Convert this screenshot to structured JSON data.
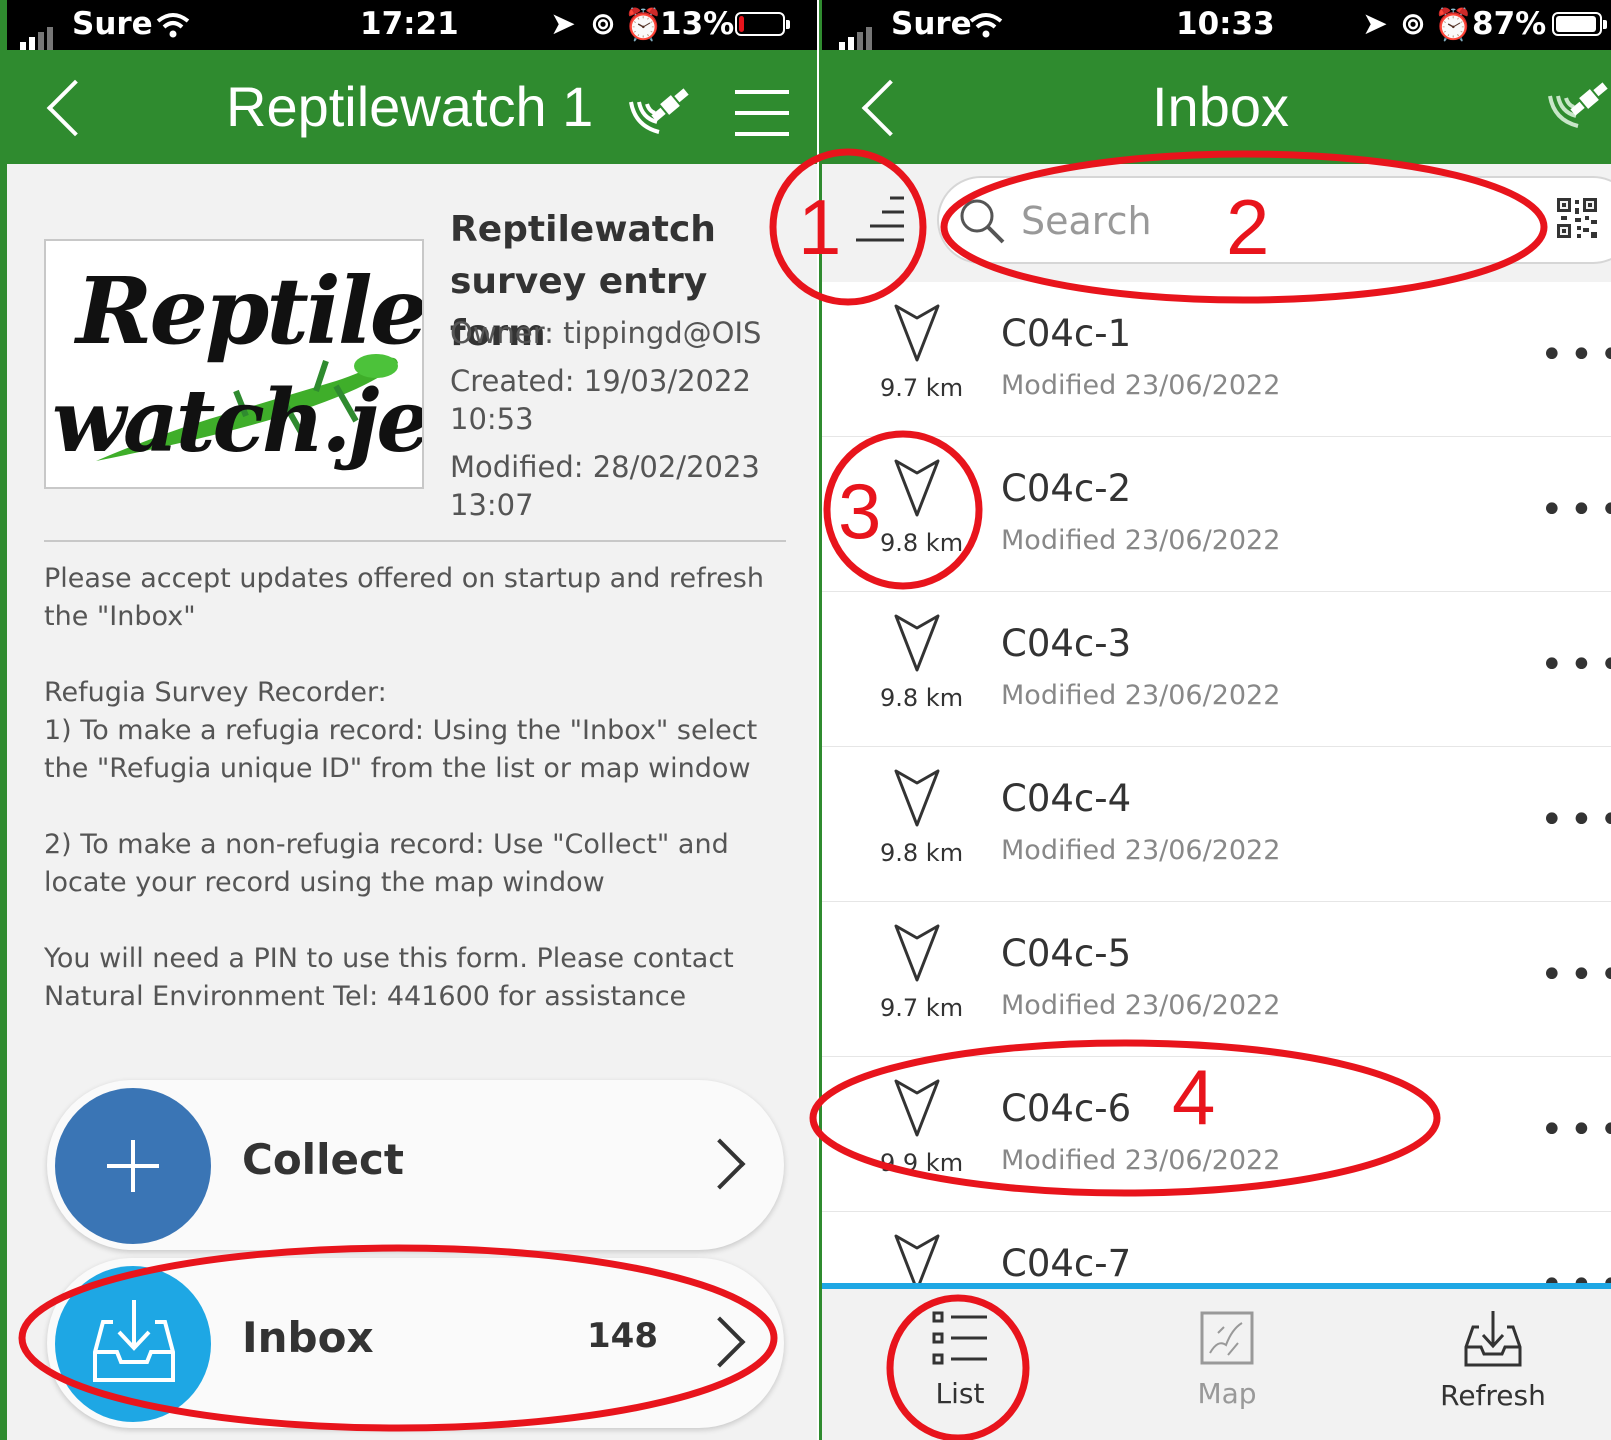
{
  "left": {
    "status": {
      "carrier": "Sure",
      "time": "17:21",
      "battery": "13%"
    },
    "header": {
      "title": "Reptilewatch 1"
    },
    "logo": {
      "line1": "Reptile",
      "line2": "watch.je"
    },
    "form": {
      "title": "Reptilewatch survey entry form",
      "owner": "Owner: tippingd@OIS",
      "created": "Created: 19/03/2022 10:53",
      "modified": "Modified: 28/02/2023 13:07"
    },
    "description": {
      "p1": "Please accept updates offered on startup and refresh the \"Inbox\"",
      "p2a": "Refugia Survey Recorder:",
      "p2b": "1) To make a refugia record: Using the \"Inbox\" select the \"Refugia unique ID\" from the list or map window",
      "p3": "2) To make a non-refugia record: Use \"Collect\" and locate your record using the map window",
      "p4": "You will need a PIN to use this form. Please contact Natural Environment Tel: 441600 for assistance"
    },
    "buttons": {
      "collect": "Collect",
      "inbox": "Inbox",
      "inbox_count": "148"
    }
  },
  "right": {
    "status": {
      "carrier": "Sure",
      "time": "10:33",
      "battery": "87%"
    },
    "header": {
      "title": "Inbox"
    },
    "search": {
      "placeholder": "Search"
    },
    "items": [
      {
        "name": "C04c-1",
        "modified": "Modified 23/06/2022",
        "distance": "9.7 km"
      },
      {
        "name": "C04c-2",
        "modified": "Modified 23/06/2022",
        "distance": "9.8 km"
      },
      {
        "name": "C04c-3",
        "modified": "Modified 23/06/2022",
        "distance": "9.8 km"
      },
      {
        "name": "C04c-4",
        "modified": "Modified 23/06/2022",
        "distance": "9.8 km"
      },
      {
        "name": "C04c-5",
        "modified": "Modified 23/06/2022",
        "distance": "9.7 km"
      },
      {
        "name": "C04c-6",
        "modified": "Modified 23/06/2022",
        "distance": "9.9 km"
      },
      {
        "name": "C04c-7",
        "modified": "",
        "distance": ""
      }
    ],
    "tabs": {
      "list": "List",
      "map": "Map",
      "refresh": "Refresh"
    }
  },
  "annotations": {
    "n1": "1",
    "n2": "2",
    "n3": "3",
    "n4": "4"
  },
  "colors": {
    "header_green": "#2f8b2f",
    "collect_blue": "#3a75b5",
    "inbox_cyan": "#1ea7e4",
    "annotation_red": "#e8141c",
    "battery_low": "#e8141c"
  }
}
